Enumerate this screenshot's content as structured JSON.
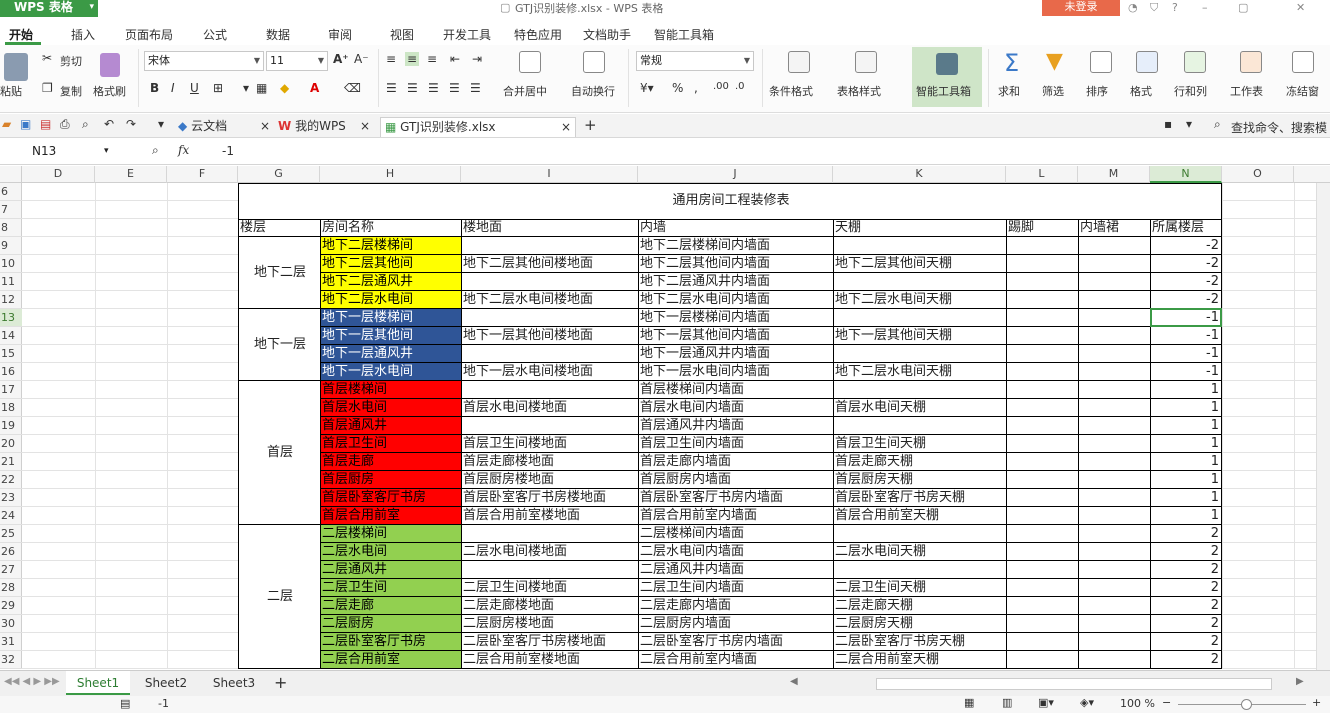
{
  "titlebar": {
    "app_name": "WPS 表格",
    "doc_title": "GTJ识别装修.xlsx - WPS 表格",
    "login_label": "未登录"
  },
  "ribbon_tabs": [
    "开始",
    "插入",
    "页面布局",
    "公式",
    "数据",
    "审阅",
    "视图",
    "开发工具",
    "特色应用",
    "文档助手",
    "智能工具箱"
  ],
  "ribbon": {
    "paste": "粘贴",
    "cut": "剪切",
    "copy": "复制",
    "format_painter": "格式刷",
    "font_name": "宋体",
    "font_size": "11",
    "merge_center": "合并居中",
    "wrap_text": "自动换行",
    "number_format": "常规",
    "conditional_format": "条件格式",
    "table_style": "表格样式",
    "smart_toolbox": "智能工具箱",
    "sum": "求和",
    "filter": "筛选",
    "sort": "排序",
    "format": "格式",
    "row_col": "行和列",
    "worksheet": "工作表",
    "freeze": "冻结窗"
  },
  "doc_tabs": [
    "云文档",
    "我的WPS",
    "GTJ识别装修.xlsx"
  ],
  "search_commands": "查找命令、搜索模",
  "formula_bar": {
    "cell_ref": "N13",
    "fx": "fx",
    "value": "-1"
  },
  "columns": [
    "D",
    "E",
    "F",
    "G",
    "H",
    "I",
    "J",
    "K",
    "L",
    "M",
    "N",
    "O"
  ],
  "rows": [
    "6",
    "7",
    "8",
    "9",
    "10",
    "11",
    "12",
    "13",
    "14",
    "15",
    "16",
    "17",
    "18",
    "19",
    "20",
    "21",
    "22",
    "23",
    "24",
    "25",
    "26",
    "27",
    "28",
    "29",
    "30",
    "31",
    "32"
  ],
  "sheet": {
    "title": "通用房间工程装修表",
    "headers": [
      "楼层",
      "房间名称",
      "楼地面",
      "内墙",
      "天棚",
      "踢脚",
      "内墙裙",
      "所属楼层"
    ],
    "groups": [
      {
        "floor": "地下二层",
        "color": "#ffff00",
        "text_color": "#000000"
      },
      {
        "floor": "地下一层",
        "color": "#2f5597",
        "text_color": "#ffffff"
      },
      {
        "floor": "首层",
        "color": "#ff0000",
        "text_color": "#000000"
      },
      {
        "floor": "二层",
        "color": "#92d050",
        "text_color": "#000000"
      }
    ],
    "data": [
      {
        "g": 0,
        "room": "地下二层楼梯间",
        "floor_f": "",
        "wall": "地下二层楼梯间内墙面",
        "ceil": "",
        "level": "-2"
      },
      {
        "g": 0,
        "room": "地下二层其他间",
        "floor_f": "地下二层其他间楼地面",
        "wall": "地下二层其他间内墙面",
        "ceil": "地下二层其他间天棚",
        "level": "-2"
      },
      {
        "g": 0,
        "room": "地下二层通风井",
        "floor_f": "",
        "wall": "地下二层通风井内墙面",
        "ceil": "",
        "level": "-2"
      },
      {
        "g": 0,
        "room": "地下二层水电间",
        "floor_f": "地下二层水电间楼地面",
        "wall": "地下二层水电间内墙面",
        "ceil": "地下二层水电间天棚",
        "level": "-2"
      },
      {
        "g": 1,
        "room": "地下一层楼梯间",
        "floor_f": "",
        "wall": "地下一层楼梯间内墙面",
        "ceil": "",
        "level": "-1"
      },
      {
        "g": 1,
        "room": "地下一层其他间",
        "floor_f": "地下一层其他间楼地面",
        "wall": "地下一层其他间内墙面",
        "ceil": "地下一层其他间天棚",
        "level": "-1"
      },
      {
        "g": 1,
        "room": "地下一层通风井",
        "floor_f": "",
        "wall": "地下一层通风井内墙面",
        "ceil": "",
        "level": "-1"
      },
      {
        "g": 1,
        "room": "地下一层水电间",
        "floor_f": "地下一层水电间楼地面",
        "wall": "地下一层水电间内墙面",
        "ceil": "地下二层水电间天棚",
        "level": "-1"
      },
      {
        "g": 2,
        "room": "首层楼梯间",
        "floor_f": "",
        "wall": "首层楼梯间内墙面",
        "ceil": "",
        "level": "1"
      },
      {
        "g": 2,
        "room": "首层水电间",
        "floor_f": "首层水电间楼地面",
        "wall": "首层水电间内墙面",
        "ceil": "首层水电间天棚",
        "level": "1"
      },
      {
        "g": 2,
        "room": "首层通风井",
        "floor_f": "",
        "wall": "首层通风井内墙面",
        "ceil": "",
        "level": "1"
      },
      {
        "g": 2,
        "room": "首层卫生间",
        "floor_f": "首层卫生间楼地面",
        "wall": "首层卫生间内墙面",
        "ceil": "首层卫生间天棚",
        "level": "1"
      },
      {
        "g": 2,
        "room": "首层走廊",
        "floor_f": "首层走廊楼地面",
        "wall": "首层走廊内墙面",
        "ceil": "首层走廊天棚",
        "level": "1"
      },
      {
        "g": 2,
        "room": "首层厨房",
        "floor_f": "首层厨房楼地面",
        "wall": "首层厨房内墙面",
        "ceil": "首层厨房天棚",
        "level": "1"
      },
      {
        "g": 2,
        "room": "首层卧室客厅书房",
        "floor_f": "首层卧室客厅书房楼地面",
        "wall": "首层卧室客厅书房内墙面",
        "ceil": "首层卧室客厅书房天棚",
        "level": "1"
      },
      {
        "g": 2,
        "room": "首层合用前室",
        "floor_f": "首层合用前室楼地面",
        "wall": "首层合用前室内墙面",
        "ceil": "首层合用前室天棚",
        "level": "1"
      },
      {
        "g": 3,
        "room": "二层楼梯间",
        "floor_f": "",
        "wall": "二层楼梯间内墙面",
        "ceil": "",
        "level": "2"
      },
      {
        "g": 3,
        "room": "二层水电间",
        "floor_f": "二层水电间楼地面",
        "wall": "二层水电间内墙面",
        "ceil": "二层水电间天棚",
        "level": "2"
      },
      {
        "g": 3,
        "room": "二层通风井",
        "floor_f": "",
        "wall": "二层通风井内墙面",
        "ceil": "",
        "level": "2"
      },
      {
        "g": 3,
        "room": "二层卫生间",
        "floor_f": "二层卫生间楼地面",
        "wall": "二层卫生间内墙面",
        "ceil": "二层卫生间天棚",
        "level": "2"
      },
      {
        "g": 3,
        "room": "二层走廊",
        "floor_f": "二层走廊楼地面",
        "wall": "二层走廊内墙面",
        "ceil": "二层走廊天棚",
        "level": "2"
      },
      {
        "g": 3,
        "room": "二层厨房",
        "floor_f": "二层厨房楼地面",
        "wall": "二层厨房内墙面",
        "ceil": "二层厨房天棚",
        "level": "2"
      },
      {
        "g": 3,
        "room": "二层卧室客厅书房",
        "floor_f": "二层卧室客厅书房楼地面",
        "wall": "二层卧室客厅书房内墙面",
        "ceil": "二层卧室客厅书房天棚",
        "level": "2"
      },
      {
        "g": 3,
        "room": "二层合用前室",
        "floor_f": "二层合用前室楼地面",
        "wall": "二层合用前室内墙面",
        "ceil": "二层合用前室天棚",
        "level": "2"
      }
    ]
  },
  "sheet_tabs": [
    "Sheet1",
    "Sheet2",
    "Sheet3"
  ],
  "status": {
    "value": "-1",
    "zoom": "100 %"
  },
  "colors": {
    "accent": "#3b9a46",
    "login": "#e8694a"
  }
}
